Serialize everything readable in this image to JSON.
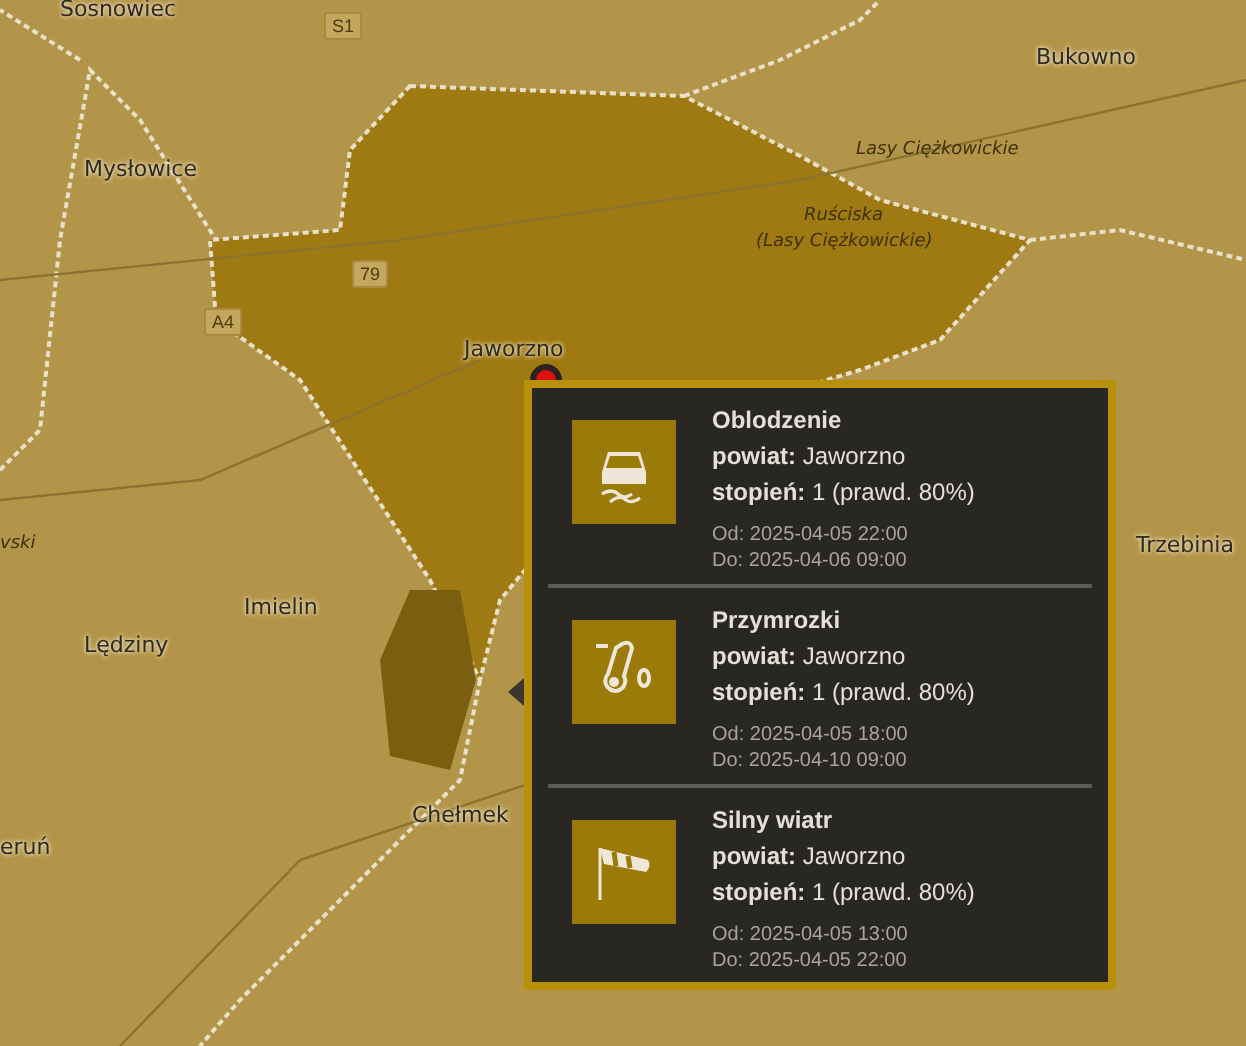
{
  "map": {
    "labels": [
      {
        "kind": "city",
        "text": "Sosnowiec"
      },
      {
        "kind": "city",
        "text": "Bukowno"
      },
      {
        "kind": "city",
        "text": "Mysłowice"
      },
      {
        "kind": "area",
        "text": "Lasy Ciężkowickie"
      },
      {
        "kind": "area",
        "text": "Ruściska"
      },
      {
        "kind": "area",
        "text": "(Lasy Ciężkowickie)"
      },
      {
        "kind": "city",
        "text": "Jaworzno"
      },
      {
        "kind": "city",
        "text": "Imielin"
      },
      {
        "kind": "city",
        "text": "Lędziny"
      },
      {
        "kind": "city",
        "text": "Chełmek"
      },
      {
        "kind": "city",
        "text": "eruń"
      },
      {
        "kind": "area",
        "text": "vski"
      },
      {
        "kind": "city",
        "text": "Trzebinia"
      },
      {
        "kind": "road",
        "text": "S1"
      },
      {
        "kind": "road",
        "text": "79"
      },
      {
        "kind": "road",
        "text": "A4"
      }
    ]
  },
  "popup": {
    "warnings": [
      {
        "kind": "ice",
        "title": "Oblodzenie",
        "county_label": "powiat:",
        "county": "Jaworzno",
        "level_label": "stopień:",
        "level_text": "1 (prawd. 80%)",
        "from": "Od: 2025-04-05 22:00",
        "to": "Do: 2025-04-06 09:00"
      },
      {
        "kind": "frost",
        "title": "Przymrozki",
        "county_label": "powiat:",
        "county": "Jaworzno",
        "level_label": "stopień:",
        "level_text": "1 (prawd. 80%)",
        "from": "Od: 2025-04-05 18:00",
        "to": "Do: 2025-04-10 09:00"
      },
      {
        "kind": "wind",
        "title": "Silny wiatr",
        "county_label": "powiat:",
        "county": "Jaworzno",
        "level_label": "stopień:",
        "level_text": "1 (prawd. 80%)",
        "from": "Od: 2025-04-05 13:00",
        "to": "Do: 2025-04-05 22:00"
      }
    ]
  }
}
